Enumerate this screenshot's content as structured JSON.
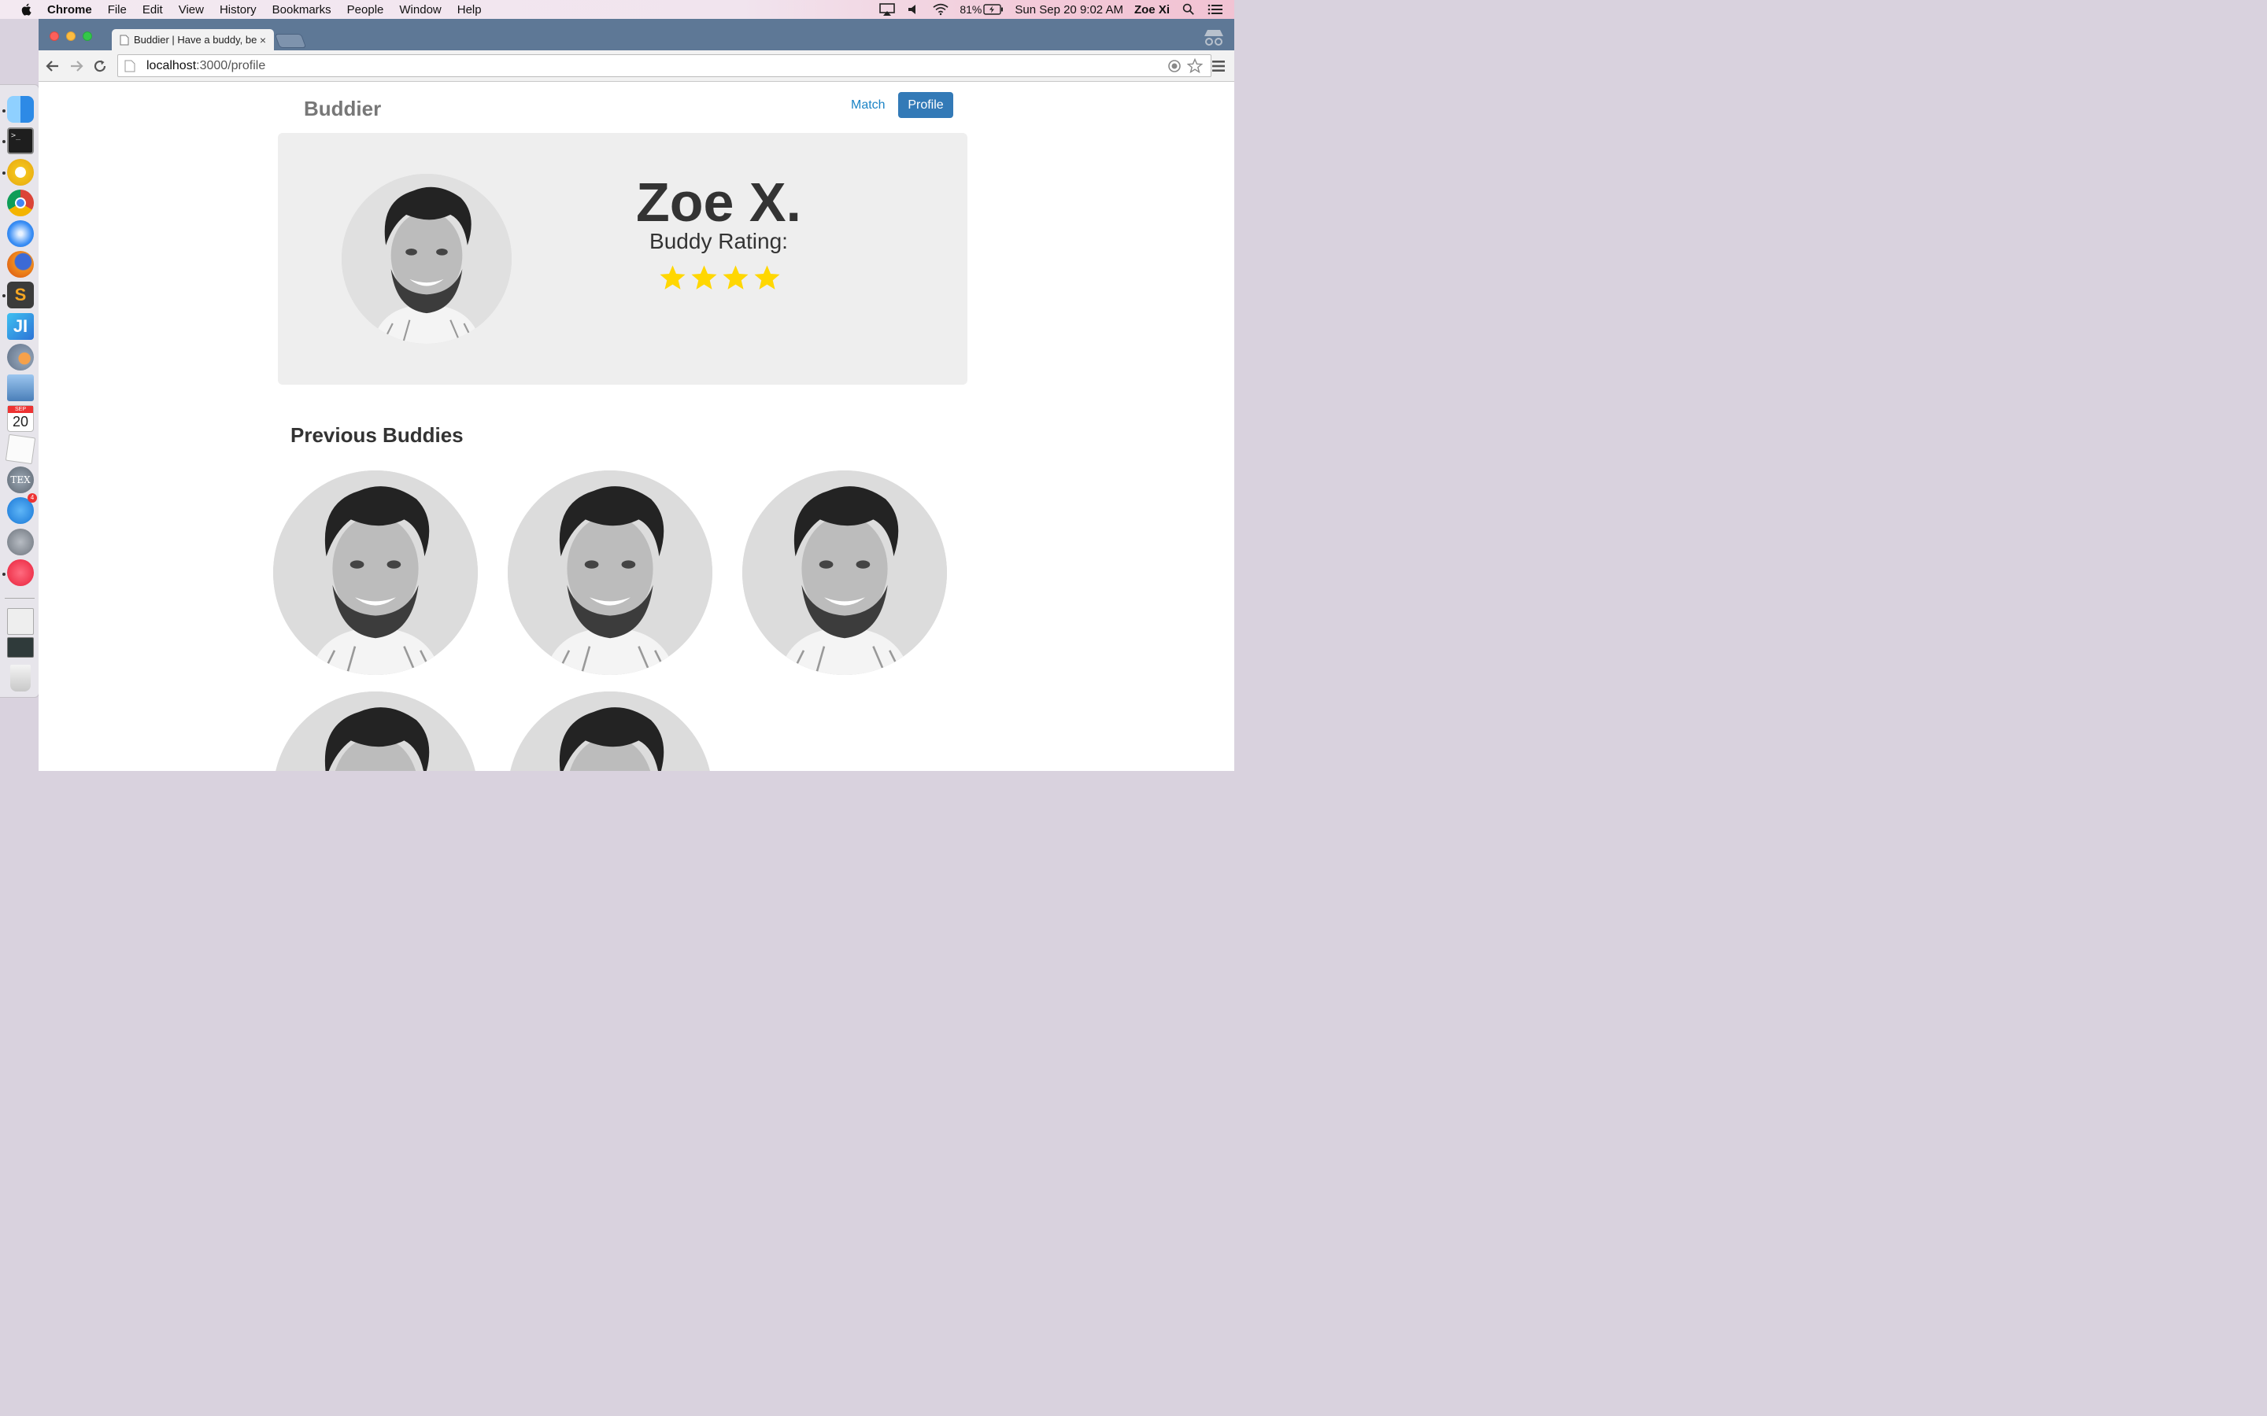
{
  "menubar": {
    "app_name": "Chrome",
    "items": [
      "File",
      "Edit",
      "View",
      "History",
      "Bookmarks",
      "People",
      "Window",
      "Help"
    ],
    "battery": "81%",
    "datetime": "Sun Sep 20  9:02 AM",
    "user": "Zoe Xi"
  },
  "dock": {
    "icons": [
      "finder-icon",
      "terminal-icon",
      "chrome-canary-icon",
      "chrome-icon",
      "safari-icon",
      "firefox-icon",
      "sublime-text-icon",
      "intellij-icon",
      "camino-icon",
      "preview-icon",
      "calendar-icon",
      "textedit-icon",
      "tex-icon",
      "app-store-icon",
      "launchpad-icon",
      "itunes-icon",
      "window-thumbnail-icon",
      "terminal-thumbnail-icon",
      "trash-icon"
    ],
    "calendar_day": "20",
    "calendar_month": "SEP",
    "app_store_badge": "4"
  },
  "browser": {
    "tab_title": "Buddier | Have a buddy, be",
    "url_host": "localhost",
    "url_path": ":3000/profile"
  },
  "site": {
    "brand": "Buddier",
    "nav": {
      "match": "Match",
      "profile": "Profile"
    }
  },
  "profile": {
    "name": "Zoe X.",
    "rating_label": "Buddy Rating:",
    "rating": 4,
    "star_color": "#ffd700"
  },
  "previous_buddies": {
    "title": "Previous Buddies",
    "count": 5
  }
}
